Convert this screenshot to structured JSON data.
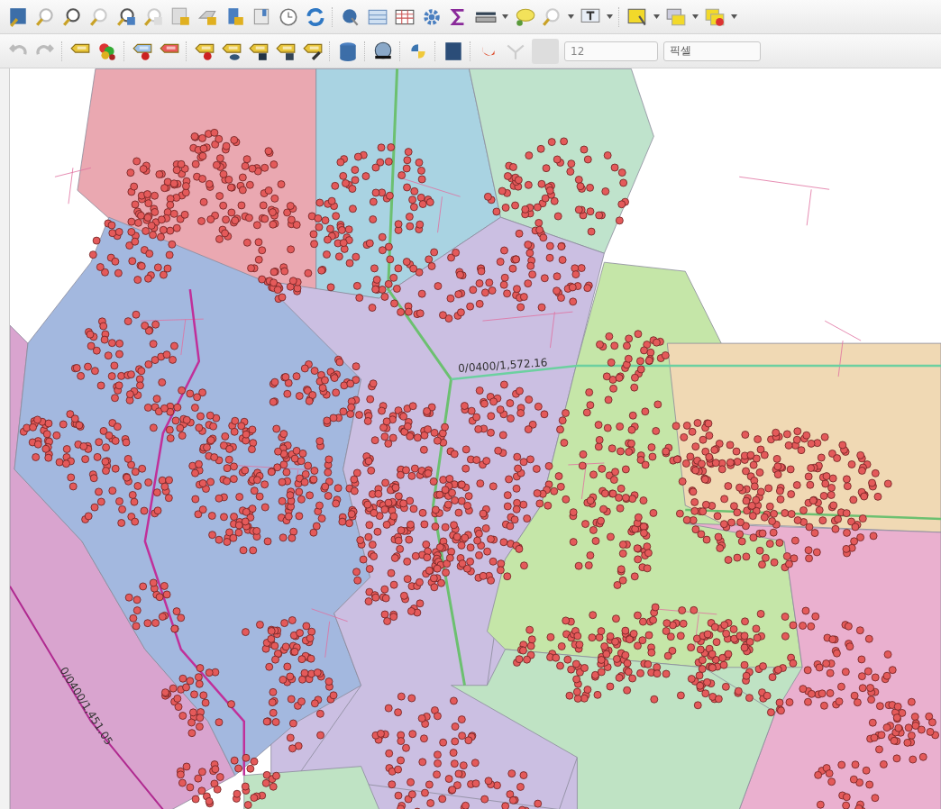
{
  "toolbar": {
    "size_field": {
      "value": "12"
    },
    "unit_dropdown": {
      "value": "픽셀"
    }
  },
  "map": {
    "labels": [
      {
        "text": "0/0400/1,572.16",
        "kind": "horizontal"
      },
      {
        "text": "0/0400/1,451.05",
        "kind": "diagonal"
      }
    ]
  }
}
